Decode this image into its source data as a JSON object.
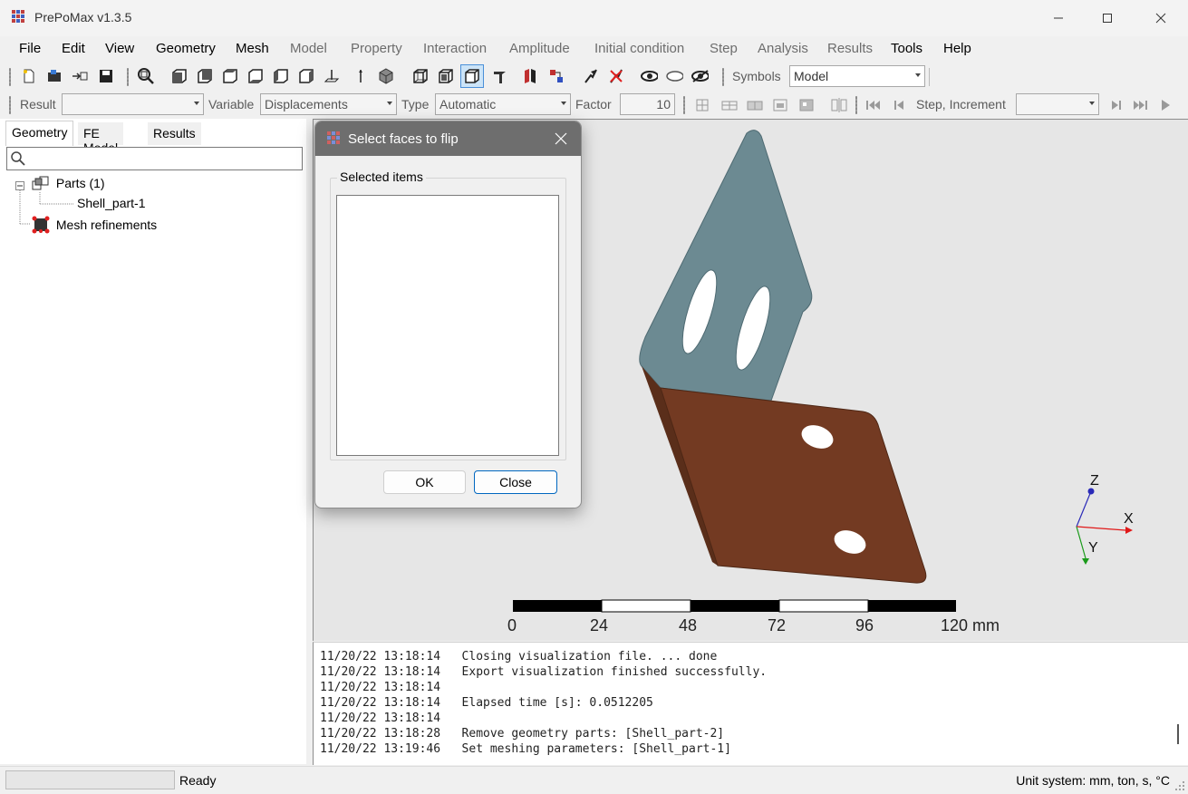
{
  "window": {
    "title": "PrePoMax v1.3.5",
    "minimize_icon": "minimize-icon",
    "maximize_icon": "maximize-icon",
    "close_icon": "close-icon"
  },
  "menu": {
    "items": [
      {
        "label": "File",
        "enabled": true
      },
      {
        "label": "Edit",
        "enabled": true
      },
      {
        "label": "View",
        "enabled": true
      },
      {
        "label": "Geometry",
        "enabled": true
      },
      {
        "label": "Mesh",
        "enabled": true
      },
      {
        "label": "Model",
        "enabled": false
      },
      {
        "label": "Property",
        "enabled": false
      },
      {
        "label": "Interaction",
        "enabled": false
      },
      {
        "label": "Amplitude",
        "enabled": false
      },
      {
        "label": "Initial condition",
        "enabled": false
      },
      {
        "label": "Step",
        "enabled": false
      },
      {
        "label": "Analysis",
        "enabled": false
      },
      {
        "label": "Results",
        "enabled": false
      },
      {
        "label": "Tools",
        "enabled": true
      },
      {
        "label": "Help",
        "enabled": true
      }
    ]
  },
  "toolbar1": {
    "symbols_label": "Symbols",
    "symbols_value": "Model"
  },
  "toolbar2": {
    "result_label": "Result",
    "result_value": "",
    "variable_label": "Variable",
    "variable_value": "Displacements",
    "type_label": "Type",
    "type_value": "Automatic",
    "factor_label": "Factor",
    "factor_value": "10",
    "step_label": "Step, Increment",
    "step_value": ""
  },
  "left_panel": {
    "tabs": [
      "Geometry",
      "FE Model",
      "Results"
    ],
    "active_tab": "Geometry",
    "search_placeholder": "",
    "tree": {
      "parts_label": "Parts (1)",
      "part_item": "Shell_part-1",
      "mesh_refinements": "Mesh refinements"
    }
  },
  "dialog": {
    "title": "Select faces to flip",
    "group_label": "Selected items",
    "ok_label": "OK",
    "close_label": "Close"
  },
  "viewport": {
    "scale_labels": [
      "0",
      "24",
      "48",
      "72",
      "96",
      "120 mm"
    ],
    "axes": {
      "z": "Z",
      "x": "X",
      "y": "Y"
    },
    "colors": {
      "background": "#e6e6e6",
      "upper_face": "#6c8a92",
      "lower_face": "#733a22",
      "axis_x": "#e01818",
      "axis_y": "#1a9a1a",
      "axis_z": "#2a2ab8"
    }
  },
  "log": {
    "lines": [
      {
        "time": "11/20/22 13:18:14",
        "text": "Closing visualization file. ... done"
      },
      {
        "time": "11/20/22 13:18:14",
        "text": "Export visualization finished successfully."
      },
      {
        "time": "11/20/22 13:18:14",
        "text": ""
      },
      {
        "time": "11/20/22 13:18:14",
        "text": "Elapsed time [s]: 0.0512205"
      },
      {
        "time": "11/20/22 13:18:14",
        "text": ""
      },
      {
        "time": "11/20/22 13:18:28",
        "text": "Remove geometry parts: [Shell_part-2]"
      },
      {
        "time": "11/20/22 13:19:46",
        "text": "Set meshing parameters: [Shell_part-1]"
      }
    ]
  },
  "status": {
    "text": "Ready",
    "units": "Unit system: mm, ton, s, °C"
  }
}
